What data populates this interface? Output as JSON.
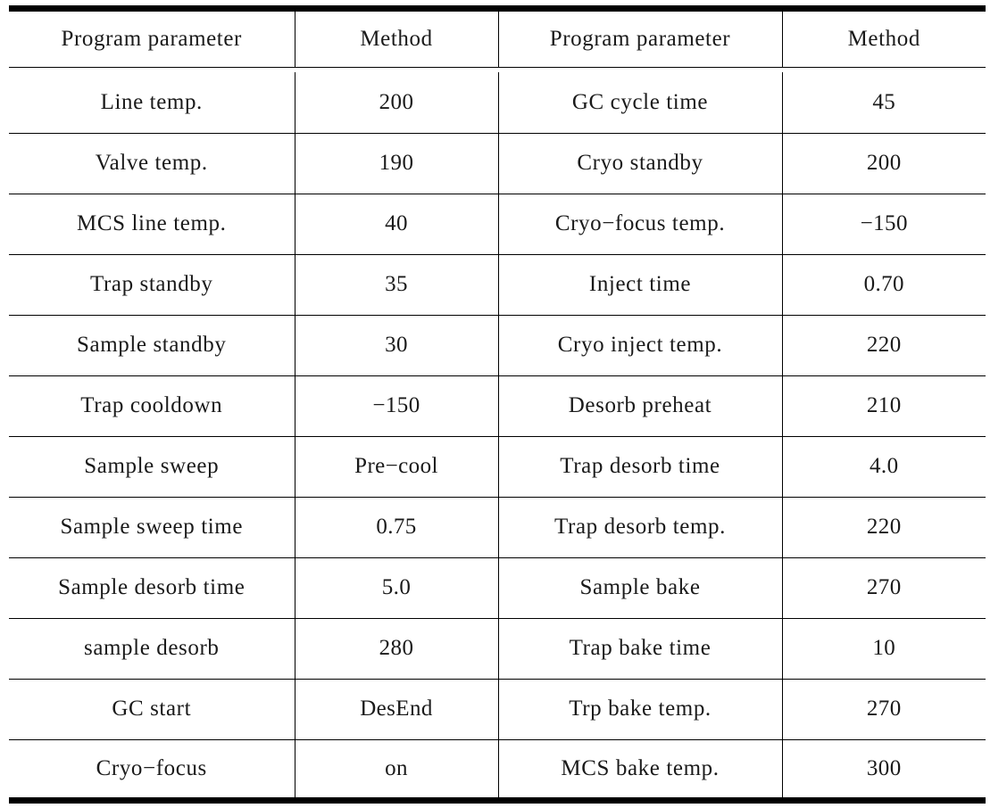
{
  "table": {
    "columns": [
      {
        "key": "param_left",
        "label": "Program parameter"
      },
      {
        "key": "method_left",
        "label": "Method"
      },
      {
        "key": "param_right",
        "label": "Program parameter"
      },
      {
        "key": "method_right",
        "label": "Method"
      }
    ],
    "rows": [
      {
        "param_left": "Line temp.",
        "method_left": "200",
        "param_right": "GC cycle time",
        "method_right": "45"
      },
      {
        "param_left": "Valve temp.",
        "method_left": "190",
        "param_right": "Cryo standby",
        "method_right": "200"
      },
      {
        "param_left": "MCS line temp.",
        "method_left": "40",
        "param_right": "Cryo−focus temp.",
        "method_right": "−150"
      },
      {
        "param_left": "Trap standby",
        "method_left": "35",
        "param_right": "Inject time",
        "method_right": "0.70"
      },
      {
        "param_left": "Sample standby",
        "method_left": "30",
        "param_right": "Cryo inject temp.",
        "method_right": "220"
      },
      {
        "param_left": "Trap cooldown",
        "method_left": "−150",
        "param_right": "Desorb preheat",
        "method_right": "210"
      },
      {
        "param_left": "Sample sweep",
        "method_left": "Pre−cool",
        "param_right": "Trap desorb time",
        "method_right": "4.0"
      },
      {
        "param_left": "Sample sweep time",
        "method_left": "0.75",
        "param_right": "Trap desorb temp.",
        "method_right": "220"
      },
      {
        "param_left": "Sample desorb time",
        "method_left": "5.0",
        "param_right": "Sample bake",
        "method_right": "270"
      },
      {
        "param_left": "sample desorb",
        "method_left": "280",
        "param_right": "Trap bake time",
        "method_right": "10"
      },
      {
        "param_left": "GC start",
        "method_left": "DesEnd",
        "param_right": "Trp bake temp.",
        "method_right": "270"
      },
      {
        "param_left": "Cryo−focus",
        "method_left": "on",
        "param_right": "MCS bake temp.",
        "method_right": "300"
      }
    ]
  },
  "style": {
    "rule_color": "#000000",
    "text_color": "#1a1a1a",
    "background": "#ffffff"
  }
}
